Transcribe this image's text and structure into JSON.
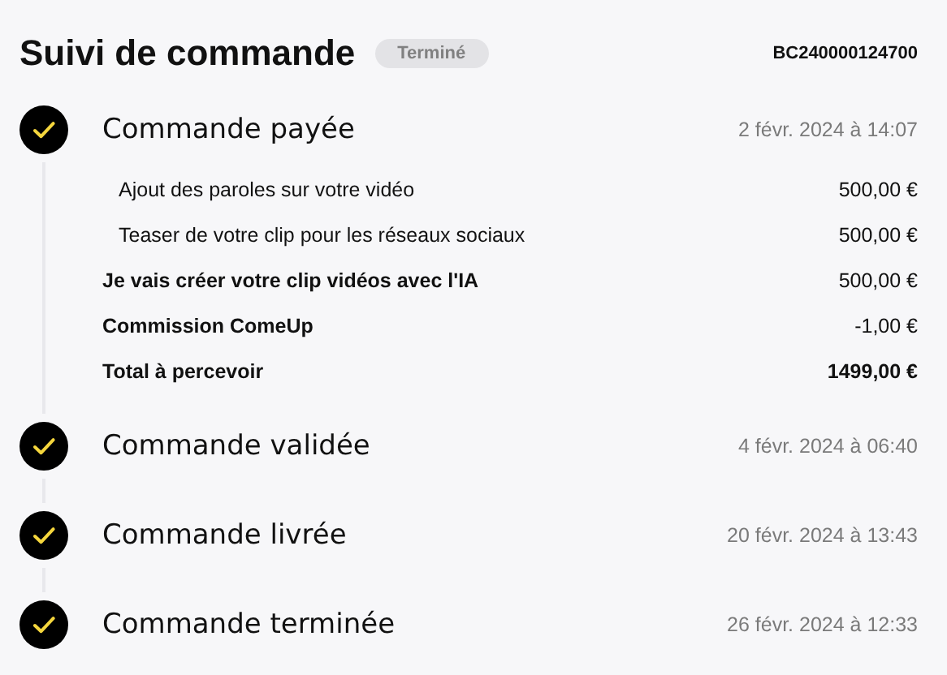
{
  "header": {
    "title": "Suivi de commande",
    "status_badge": "Terminé",
    "order_number": "BC240000124700"
  },
  "steps": [
    {
      "title": "Commande payée",
      "date": "2 févr. 2024 à 14:07",
      "done": true,
      "details": [
        {
          "kind": "option",
          "label": "Ajout des paroles sur votre vidéo",
          "amount": "500,00 €"
        },
        {
          "kind": "option",
          "label": "Teaser de votre clip pour les réseaux sociaux",
          "amount": "500,00 €"
        },
        {
          "kind": "service",
          "label": "Je vais créer votre clip vidéos avec l'IA",
          "amount": "500,00 €"
        },
        {
          "kind": "fee",
          "label": "Commission ComeUp",
          "amount": "-1,00 €"
        },
        {
          "kind": "total",
          "label": "Total à percevoir",
          "amount": "1499,00 €"
        }
      ]
    },
    {
      "title": "Commande validée",
      "date": "4 févr. 2024 à 06:40",
      "done": true
    },
    {
      "title": "Commande livrée",
      "date": "20 févr. 2024 à 13:43",
      "done": true
    },
    {
      "title": "Commande terminée",
      "date": "26 févr. 2024 à 12:33",
      "done": true
    }
  ]
}
